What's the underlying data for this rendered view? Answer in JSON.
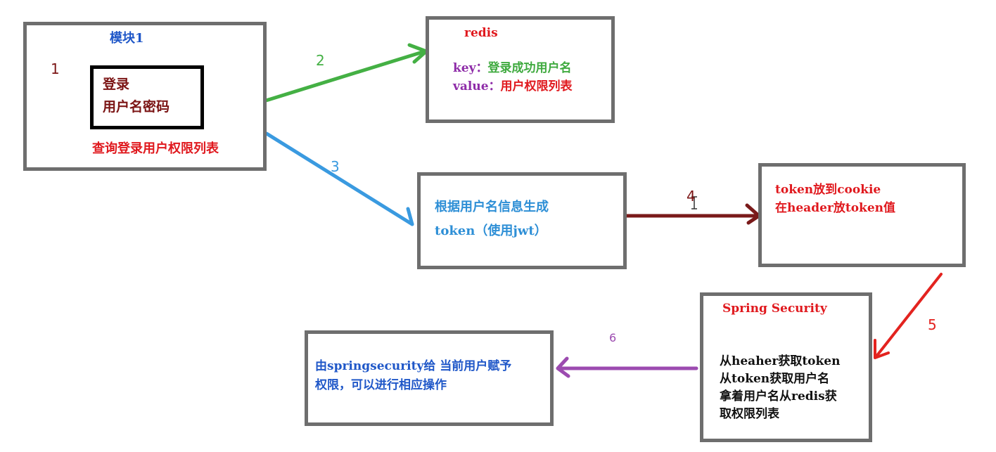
{
  "colors": {
    "box_border": "#6e6e6e",
    "inner_border": "#000000",
    "red": "#e0191e",
    "dark_red": "#7b1414",
    "blue": "#1f57c8",
    "light_blue": "#2e8fd6",
    "purple": "#8e2ca8",
    "green": "#3faa3f",
    "black": "#111111",
    "arrow_dark_red": "#7a1a1a",
    "arrow_green": "#44b044",
    "arrow_blue": "#3a9ae0",
    "arrow_red": "#e3231f",
    "arrow_purple": "#9c4bb0"
  },
  "module1": {
    "title": "模块1",
    "login_line1": "登录",
    "login_line2": "用户名密码",
    "query": "查询登录用户权限列表"
  },
  "redis": {
    "title": "redis",
    "key_label": "key：",
    "key_value": "登录成功用户名",
    "value_label": "value：",
    "value_value": "用户权限列表"
  },
  "token_gen": {
    "line1": "根据用户名信息生成",
    "line2": "token（使用jwt）"
  },
  "cookie": {
    "line1": "token放到cookie",
    "line2": "在header放token值"
  },
  "spring": {
    "title": "Spring Security",
    "line1": "从heaher获取token",
    "line2": "从token获取用户名",
    "line3": "拿着用户名从redis获",
    "line4": "取权限列表"
  },
  "grant": {
    "line1": "由springsecurity给 当前用户赋予",
    "line2": "权限，可以进行相应操作"
  },
  "steps": {
    "s1": "1",
    "s2": "2",
    "s3": "3",
    "s4": "4",
    "s5": "5",
    "s6": "6"
  }
}
